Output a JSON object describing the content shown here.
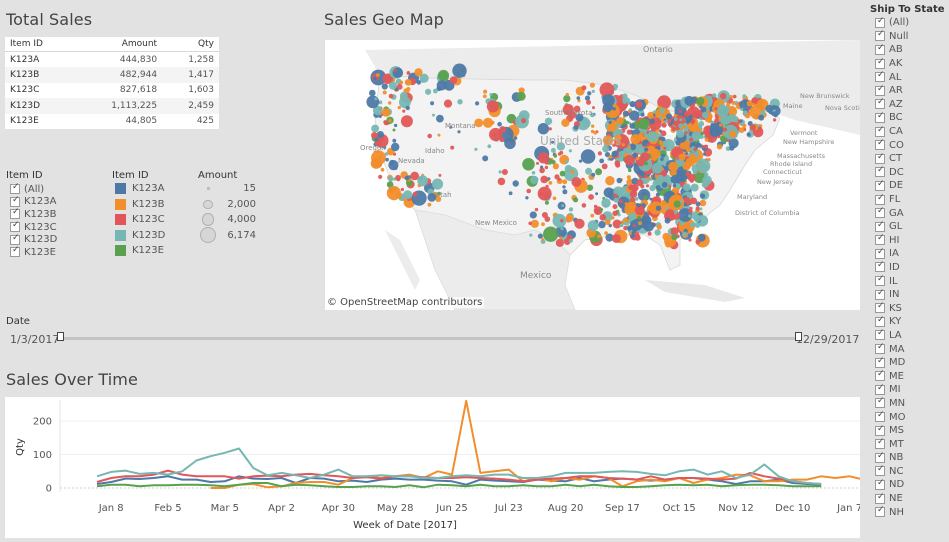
{
  "total_sales": {
    "title": "Total Sales",
    "columns": [
      "Item ID",
      "Amount",
      "Qty"
    ],
    "rows": [
      {
        "id": "K123A",
        "amount": "444,830",
        "qty": "1,258"
      },
      {
        "id": "K123B",
        "amount": "482,944",
        "qty": "1,417"
      },
      {
        "id": "K123C",
        "amount": "827,618",
        "qty": "1,603"
      },
      {
        "id": "K123D",
        "amount": "1,113,225",
        "qty": "2,459"
      },
      {
        "id": "K123E",
        "amount": "44,805",
        "qty": "425"
      }
    ]
  },
  "item_filter": {
    "title": "Item ID",
    "items": [
      {
        "label": "(All)",
        "checked": true
      },
      {
        "label": "K123A",
        "checked": true
      },
      {
        "label": "K123B",
        "checked": true
      },
      {
        "label": "K123C",
        "checked": true
      },
      {
        "label": "K123D",
        "checked": true
      },
      {
        "label": "K123E",
        "checked": true
      }
    ]
  },
  "color_legend": {
    "title": "Item ID",
    "items": [
      {
        "label": "K123A",
        "color": "#4e79a7"
      },
      {
        "label": "K123B",
        "color": "#f28e2b"
      },
      {
        "label": "K123C",
        "color": "#e15759"
      },
      {
        "label": "K123D",
        "color": "#76b7b2"
      },
      {
        "label": "K123E",
        "color": "#59a14f"
      }
    ]
  },
  "size_legend": {
    "title": "Amount",
    "items": [
      {
        "label": "15",
        "value": 15
      },
      {
        "label": "2,000",
        "value": 2000
      },
      {
        "label": "4,000",
        "value": 4000
      },
      {
        "label": "6,174",
        "value": 6174
      }
    ]
  },
  "map": {
    "title": "Sales Geo Map",
    "attribution": "© OpenStreetMap contributors",
    "labels": {
      "ontario": "Ontario",
      "us": "United States",
      "mexico": "Mexico",
      "oregon": "Oregon",
      "idaho": "Idaho",
      "montana": "Montana",
      "nevada": "Nevada",
      "utah": "Utah",
      "south_dakota": "South Dakota",
      "new_mexico": "New Mexico",
      "new_brunswick": "New Brunswick",
      "maine": "Maine",
      "nova_scotia": "Nova Scotia",
      "vermont": "Vermont",
      "new_hampshire": "New Hampshire",
      "massachusetts": "Massachusetts",
      "rhode_island": "Rhode Island",
      "connecticut": "Connecticut",
      "new_jersey": "New Jersey",
      "maryland": "Maryland",
      "dc": "District of Columbia"
    }
  },
  "date_filter": {
    "title": "Date",
    "start": "1/3/2017",
    "end": "12/29/2017"
  },
  "state_filter": {
    "title": "Ship To State",
    "items": [
      "(All)",
      "Null",
      "AB",
      "AK",
      "AL",
      "AR",
      "AZ",
      "BC",
      "CA",
      "CO",
      "CT",
      "DC",
      "DE",
      "FL",
      "GA",
      "GL",
      "HI",
      "IA",
      "ID",
      "IL",
      "IN",
      "KS",
      "KY",
      "LA",
      "MA",
      "MD",
      "ME",
      "MI",
      "MN",
      "MO",
      "MS",
      "MT",
      "NB",
      "NC",
      "ND",
      "NE",
      "NH"
    ]
  },
  "chart_data": {
    "type": "line",
    "title": "Sales Over Time",
    "xlabel": "Week of Date [2017]",
    "ylabel": "Qty",
    "ylim": [
      0,
      260
    ],
    "yticks": [
      0,
      100,
      200
    ],
    "grid": true,
    "xticks": [
      "Jan 8",
      "Feb 5",
      "Mar 5",
      "Apr 2",
      "Apr 30",
      "May 28",
      "Jun 25",
      "Jul 23",
      "Aug 20",
      "Sep 17",
      "Oct 15",
      "Nov 12",
      "Dec 10",
      "Jan 7"
    ],
    "x_start_week": "Jan 1",
    "series": [
      {
        "name": "K123A",
        "color": "#4e79a7",
        "start_week": 0,
        "values": [
          12,
          18,
          28,
          27,
          30,
          35,
          25,
          25,
          18,
          20,
          35,
          28,
          27,
          30,
          15,
          30,
          28,
          20,
          22,
          18,
          25,
          28,
          25,
          25,
          22,
          20,
          10,
          25,
          22,
          20,
          18,
          25,
          22,
          20,
          30,
          20,
          25,
          28,
          25,
          22,
          25,
          30,
          30,
          25,
          20,
          12,
          20,
          20,
          25,
          15,
          12,
          10
        ]
      },
      {
        "name": "K123B",
        "color": "#f28e2b",
        "start_week": 8,
        "values": [
          0,
          0,
          10,
          12,
          2,
          5,
          15,
          18,
          18,
          10,
          30,
          35,
          30,
          35,
          40,
          30,
          50,
          40,
          260,
          45,
          50,
          55,
          20,
          30,
          20,
          30,
          25,
          35,
          30,
          5,
          20,
          25,
          20,
          30,
          15,
          25,
          30,
          40,
          38,
          20,
          20,
          25,
          25,
          35,
          30,
          35,
          25,
          20,
          18,
          15
        ]
      },
      {
        "name": "K123C",
        "color": "#e15759",
        "start_week": 0,
        "values": [
          18,
          30,
          35,
          35,
          40,
          52,
          40,
          35,
          35,
          35,
          28,
          35,
          37,
          35,
          40,
          42,
          38,
          35,
          30,
          32,
          28,
          35,
          35,
          32,
          30,
          30,
          32,
          30,
          28,
          25,
          20,
          25,
          28,
          30,
          35,
          35,
          30,
          28,
          25,
          35,
          25,
          30,
          30,
          28,
          25,
          28,
          45,
          35,
          28,
          20,
          15,
          12
        ]
      },
      {
        "name": "K123D",
        "color": "#76b7b2",
        "start_week": 0,
        "values": [
          35,
          48,
          52,
          42,
          45,
          40,
          50,
          82,
          95,
          105,
          118,
          60,
          38,
          45,
          38,
          30,
          40,
          55,
          35,
          35,
          38,
          35,
          35,
          30,
          30,
          35,
          38,
          35,
          40,
          40,
          30,
          30,
          35,
          45,
          45,
          45,
          48,
          50,
          48,
          42,
          38,
          50,
          55,
          40,
          50,
          30,
          40,
          70,
          35,
          20,
          15,
          12
        ]
      },
      {
        "name": "K123E",
        "color": "#59a14f",
        "start_week": 0,
        "values": [
          5,
          10,
          10,
          5,
          8,
          8,
          10,
          10,
          8,
          5,
          10,
          15,
          15,
          5,
          10,
          8,
          5,
          3,
          3,
          5,
          5,
          3,
          8,
          2,
          10,
          8,
          5,
          10,
          5,
          5,
          8,
          5,
          5,
          10,
          5,
          10,
          5,
          3,
          3,
          5,
          8,
          10,
          8,
          10,
          5,
          8,
          10,
          10,
          8,
          5,
          5,
          5
        ]
      }
    ]
  }
}
